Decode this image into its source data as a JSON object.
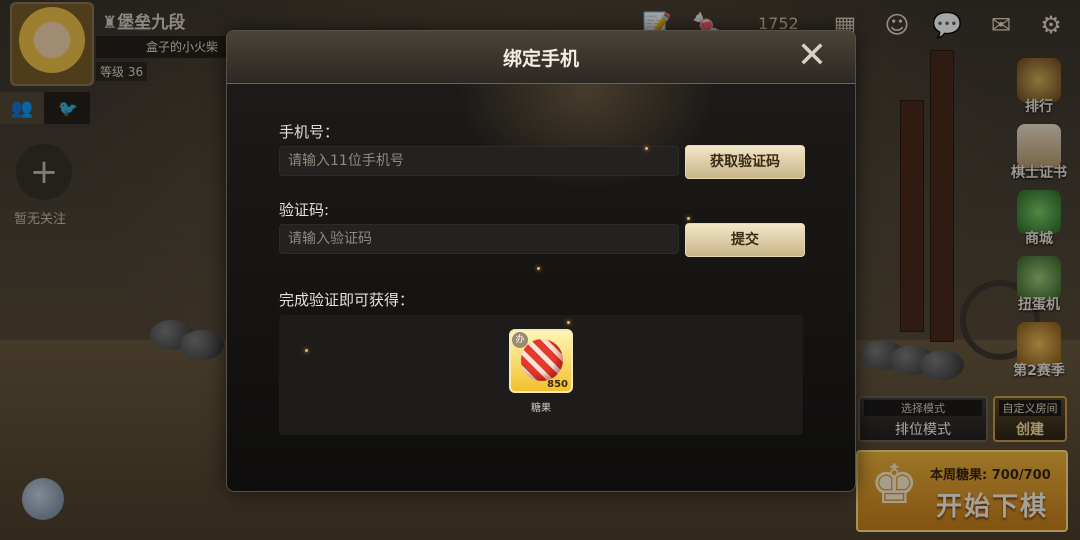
{
  "profile": {
    "rank_title": "堡垒九段",
    "nickname": "盒子的小火柴",
    "level": "等级 36"
  },
  "left_panel": {
    "add_icon": "plus-icon",
    "empty_follow": "暂无关注"
  },
  "top_bar": {
    "currency_value": "1752"
  },
  "right_menu": {
    "items": [
      {
        "label": "排行",
        "icon": "trophy-icon"
      },
      {
        "label": "棋士证书",
        "icon": "certificate-icon"
      },
      {
        "label": "商城",
        "icon": "shop-icon"
      },
      {
        "label": "扭蛋机",
        "icon": "gacha-icon"
      },
      {
        "label": "第2赛季",
        "icon": "season-icon"
      }
    ]
  },
  "mode": {
    "select_label": "选择模式",
    "selected_value": "排位模式",
    "custom_room_label": "自定义房间",
    "create_label": "创建"
  },
  "start": {
    "candy_text": "本周糖果: 700/700",
    "start_label": "开始下棋"
  },
  "dialog": {
    "title": "绑定手机",
    "phone_label": "手机号：",
    "phone_placeholder": "请输入11位手机号",
    "get_code_button": "获取验证码",
    "code_label": "验证码:",
    "code_placeholder": "请输入验证码",
    "submit_button": "提交",
    "reward_label": "完成验证即可获得：",
    "reward_item": {
      "name": "糖果",
      "quantity": "850",
      "icon": "candy-icon"
    }
  },
  "colors": {
    "accent_gold": "#f0b53c",
    "dialog_bg": "#141210"
  }
}
